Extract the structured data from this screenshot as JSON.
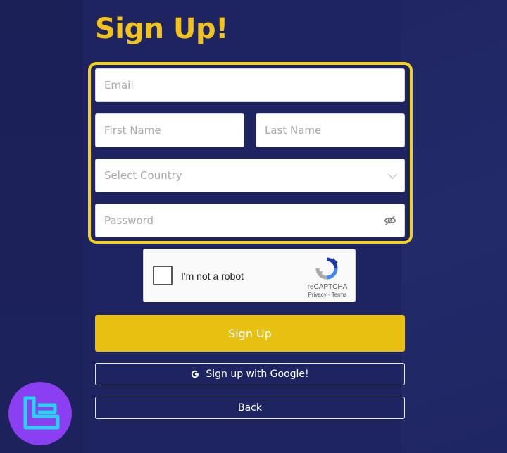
{
  "page": {
    "title": "Sign Up!"
  },
  "form": {
    "email_placeholder": "Email",
    "first_name_placeholder": "First Name",
    "last_name_placeholder": "Last Name",
    "country_placeholder": "Select Country",
    "password_placeholder": "Password"
  },
  "captcha": {
    "label": "I'm not a robot",
    "brand": "reCAPTCHA",
    "privacy": "Privacy",
    "separator": " - ",
    "terms": "Terms"
  },
  "buttons": {
    "signup_label": "Sign Up",
    "google_label": "Sign up with Google!",
    "back_label": "Back"
  },
  "icons": {
    "country_dropdown": "chevron-down-icon",
    "password_toggle": "eye-slash-icon",
    "google": "google-g-icon",
    "captcha_logo": "recaptcha-icon",
    "brand_logo": "logo-icon"
  },
  "colors": {
    "background": "#1e2460",
    "accent": "#f2c21d",
    "button": "#e8c110",
    "frame": "#f5d21a",
    "badge": "#8a3ff0",
    "logo_stroke": "#28d3f0"
  }
}
